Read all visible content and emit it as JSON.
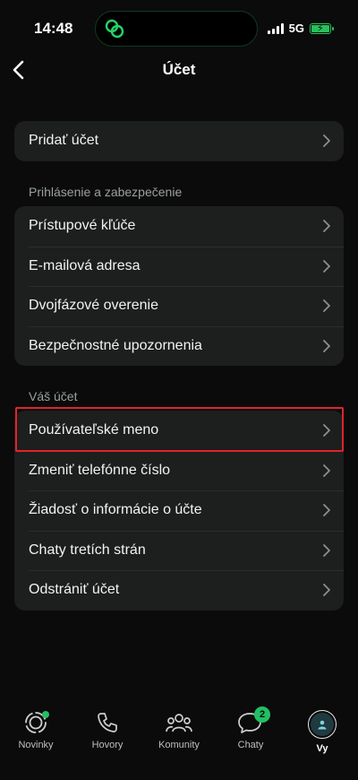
{
  "status_bar": {
    "time": "14:48",
    "network": "5G"
  },
  "header": {
    "title": "Účet"
  },
  "group_add": {
    "items": [
      {
        "label": "Pridať účet"
      }
    ]
  },
  "security": {
    "header": "Prihlásenie a zabezpečenie",
    "items": [
      {
        "label": "Prístupové kľúče"
      },
      {
        "label": "E-mailová adresa"
      },
      {
        "label": "Dvojfázové overenie"
      },
      {
        "label": "Bezpečnostné upozornenia"
      }
    ]
  },
  "account": {
    "header": "Váš účet",
    "items": [
      {
        "label": "Používateľské meno"
      },
      {
        "label": "Zmeniť telefónne číslo"
      },
      {
        "label": "Žiadosť o informácie o účte"
      },
      {
        "label": "Chaty tretích strán"
      },
      {
        "label": "Odstrániť účet"
      }
    ]
  },
  "tabbar": {
    "tabs": [
      {
        "label": "Novinky"
      },
      {
        "label": "Hovory"
      },
      {
        "label": "Komunity"
      },
      {
        "label": "Chaty",
        "badge": "2"
      },
      {
        "label": "Vy"
      }
    ]
  },
  "colors": {
    "accent": "#21c063",
    "highlight": "#e0242a",
    "card": "#1d1e1e"
  }
}
